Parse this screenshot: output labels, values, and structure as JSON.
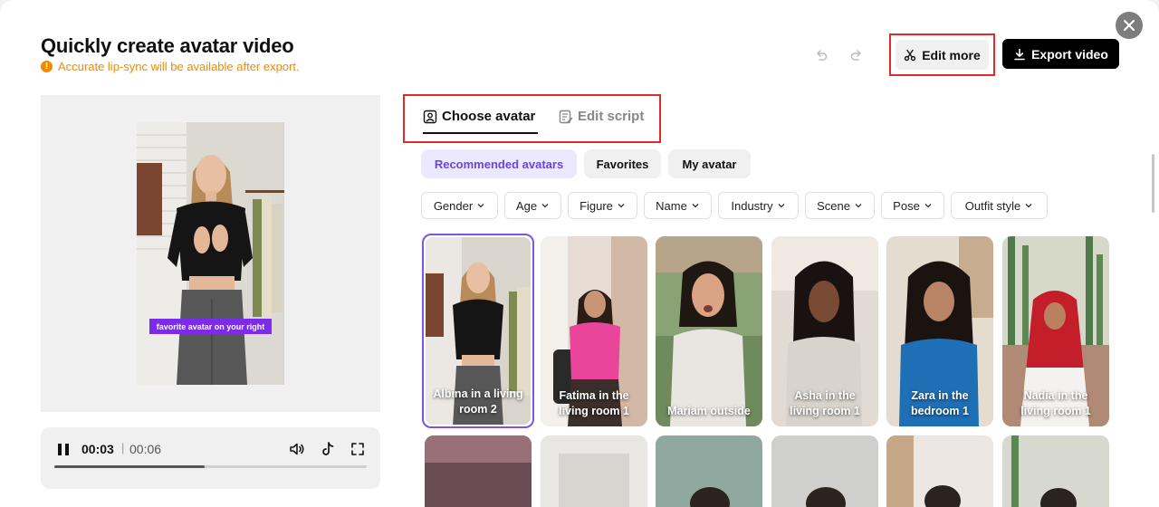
{
  "header": {
    "title": "Quickly create avatar video",
    "notice": "Accurate lip-sync will be available after export.",
    "edit_more": "Edit more",
    "export": "Export video"
  },
  "preview": {
    "caption": "favorite avatar on your right"
  },
  "player": {
    "current_time": "00:03",
    "separator": "|",
    "total_time": "00:06",
    "progress_fraction": 0.48
  },
  "tabs": [
    {
      "label": "Choose avatar",
      "active": true
    },
    {
      "label": "Edit script",
      "active": false
    }
  ],
  "categories": [
    {
      "label": "Recommended avatars",
      "active": true
    },
    {
      "label": "Favorites",
      "active": false
    },
    {
      "label": "My avatar",
      "active": false
    }
  ],
  "filters": [
    "Gender",
    "Age",
    "Figure",
    "Name",
    "Industry",
    "Scene",
    "Pose",
    "Outfit style"
  ],
  "avatars": [
    {
      "line1": "Albina in a living",
      "line2": "room 2",
      "selected": true
    },
    {
      "line1": "Fatima in the",
      "line2": "living room 1",
      "selected": false
    },
    {
      "line1": "",
      "line2": "Mariam outside",
      "selected": false
    },
    {
      "line1": "Asha in the",
      "line2": "living room 1",
      "selected": false
    },
    {
      "line1": "Zara in the",
      "line2": "bedroom 1",
      "selected": false
    },
    {
      "line1": "Nadia in the",
      "line2": "living room 1",
      "selected": false
    }
  ],
  "colors": {
    "accent": "#6b45e0",
    "highlight_box": "#e12a2a",
    "notice": "#f08a00"
  }
}
